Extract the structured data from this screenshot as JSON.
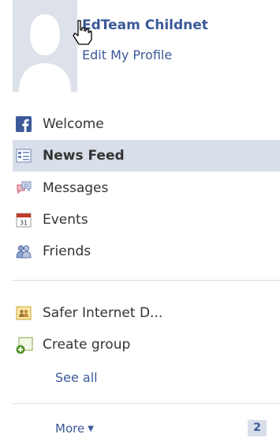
{
  "profile": {
    "name": "EdTeam Childnet",
    "edit_link": "Edit My Profile"
  },
  "nav": {
    "items": [
      {
        "label": "Welcome",
        "icon": "facebook-icon",
        "selected": false
      },
      {
        "label": "News Feed",
        "icon": "news-feed-icon",
        "selected": true
      },
      {
        "label": "Messages",
        "icon": "messages-icon",
        "selected": false
      },
      {
        "label": "Events",
        "icon": "calendar-icon",
        "selected": false
      },
      {
        "label": "Friends",
        "icon": "friends-icon",
        "selected": false
      }
    ]
  },
  "groups": {
    "items": [
      {
        "label": "Safer Internet D...",
        "icon": "group-icon"
      },
      {
        "label": "Create group",
        "icon": "create-group-icon"
      }
    ],
    "see_all": "See all"
  },
  "more": {
    "label": "More",
    "badge": "2"
  },
  "calendar_icon_text": "31",
  "colors": {
    "link": "#3b5998",
    "selected_bg": "#d8dfea",
    "avatar_bg": "#dce1ea"
  }
}
